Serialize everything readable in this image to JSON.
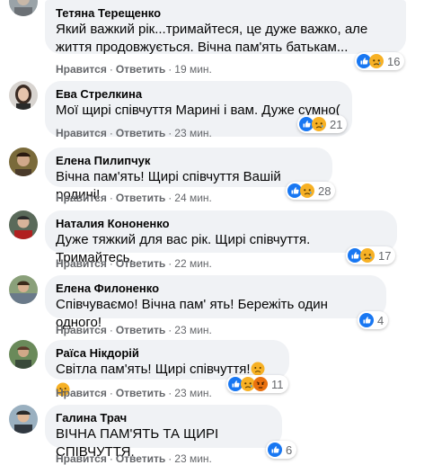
{
  "comments": [
    {
      "author": "Тетяна Терещенко",
      "text": "Який важкий рік...тримайтеся, це дуже важко, але\nжиття продовжується. Вічна пам'ять батькам...",
      "like_label": "Нравится",
      "reply_label": "Ответить",
      "time": "19 мин.",
      "reaction_count": "16",
      "reaction_icons": [
        "like-icon",
        "sad-icon"
      ]
    },
    {
      "author": "Ева Стрелкина",
      "text": "Мої щирі співчуття Марині і вам. Дуже сумно(",
      "like_label": "Нравится",
      "reply_label": "Ответить",
      "time": "23 мин.",
      "reaction_count": "21",
      "reaction_icons": [
        "like-icon",
        "sad-icon"
      ]
    },
    {
      "author": "Елена Пилипчук",
      "text": "Вічна пам'ять! Щирі співчуття Вашій родині!",
      "like_label": "Нравится",
      "reply_label": "Ответить",
      "time": "24 мин.",
      "reaction_count": "28",
      "reaction_icons": [
        "like-icon",
        "sad-icon"
      ]
    },
    {
      "author": "Наталия Кононенко",
      "text": "Дуже тяжкий для вас рік. Щирі співчуття. Тримайтесь.",
      "like_label": "Нравится",
      "reply_label": "Ответить",
      "time": "22 мин.",
      "reaction_count": "17",
      "reaction_icons": [
        "like-icon",
        "sad-icon"
      ]
    },
    {
      "author": "Елена Филоненко",
      "text": "Співчуваємо! Вічна пам' ять! Бережіть один одного!",
      "like_label": "Нравится",
      "reply_label": "Ответить",
      "time": "23 мин.",
      "reaction_count": "4",
      "reaction_icons": [
        "like-icon"
      ]
    },
    {
      "author": "Раїса Нікдорій",
      "text": "Світла пам'ять! Щирі співчуття!",
      "text_emojis": [
        "sad-emoji",
        "sad-emoji"
      ],
      "like_label": "Нравится",
      "reply_label": "Ответить",
      "time": "23 мин.",
      "reaction_count": "11",
      "reaction_icons": [
        "like-icon",
        "sad-icon",
        "angry-icon"
      ]
    },
    {
      "author": "Галина Трач",
      "text": "ВІЧНА ПАМ'ЯТЬ ТА ЩИРІ СПІВЧУТТЯ.",
      "like_label": "Нравится",
      "reply_label": "Ответить",
      "time": "23 мин.",
      "reaction_count": "6",
      "reaction_icons": [
        "like-icon"
      ]
    }
  ],
  "colors": {
    "bubble": "#f0f2f5",
    "meta_text": "#65676b",
    "like_blue": "#1877f2",
    "sad_yellow": "#f7b125",
    "angry_orange": "#e9710f"
  }
}
